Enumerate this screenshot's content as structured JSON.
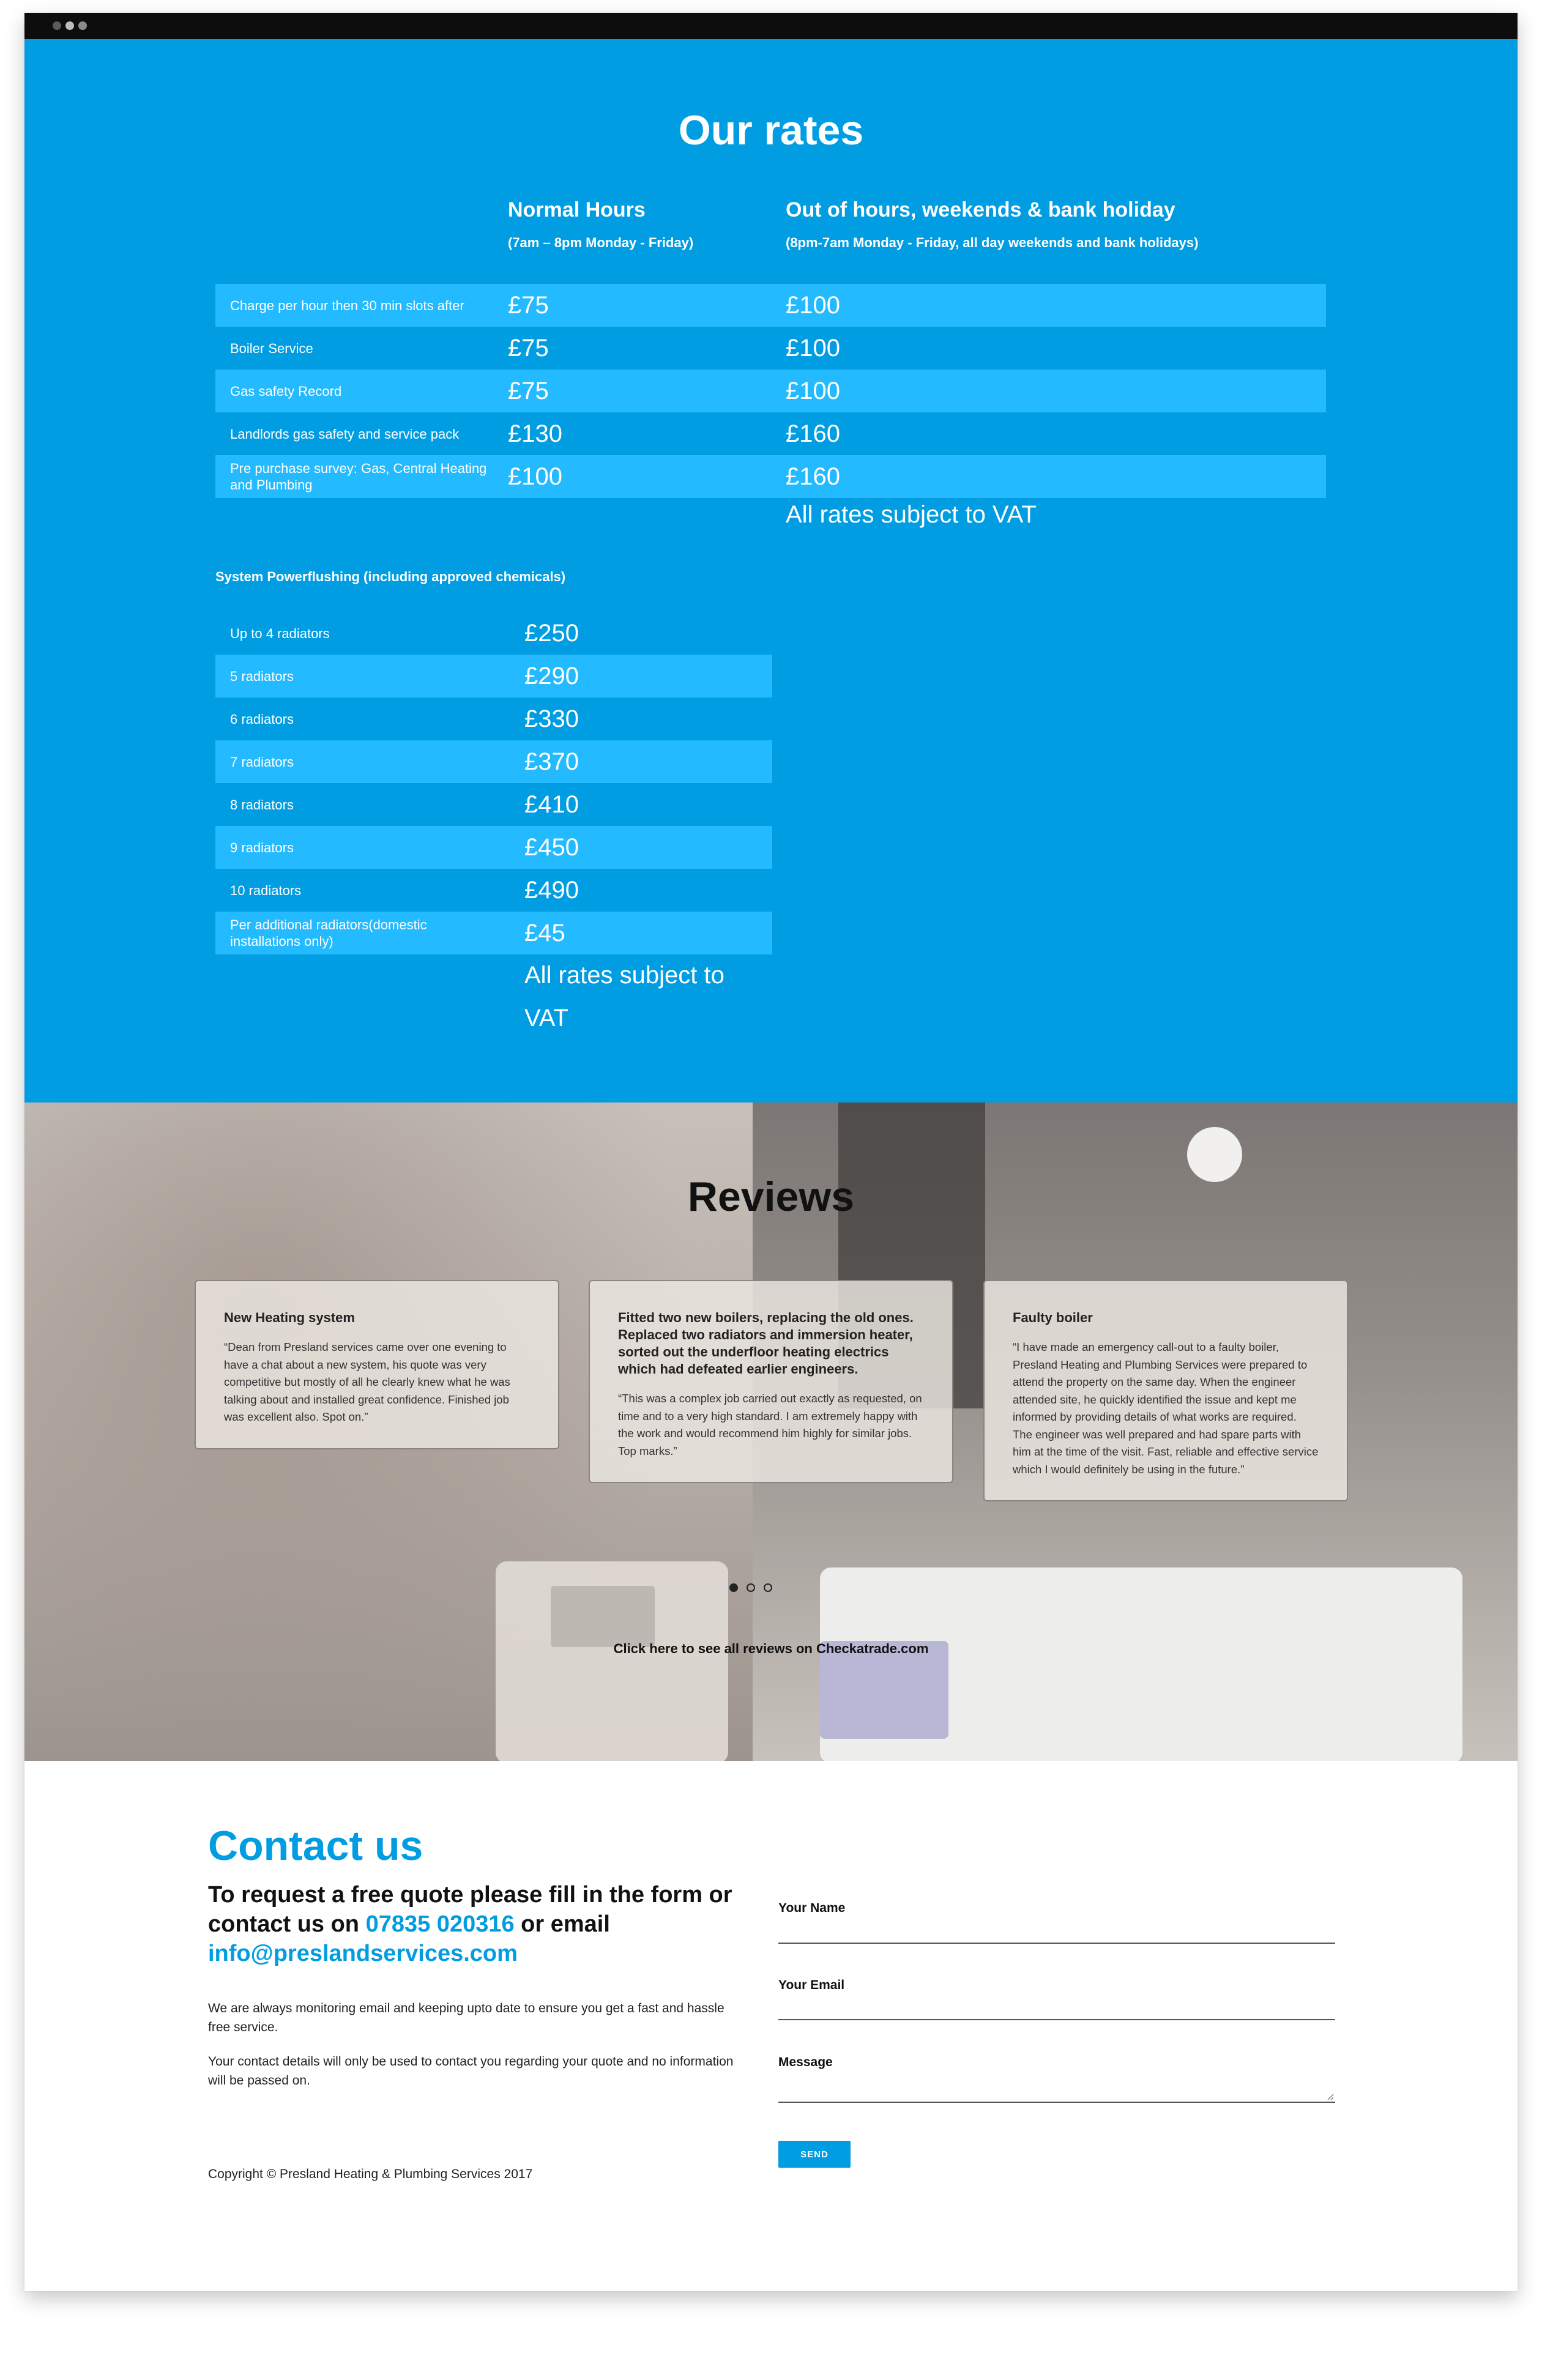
{
  "rates": {
    "title": "Our rates",
    "columns": {
      "normal": {
        "heading": "Normal Hours",
        "sub": "(7am – 8pm Monday - Friday)"
      },
      "out": {
        "heading": "Out of hours, weekends & bank holiday",
        "sub": "(8pm-7am Monday - Friday, all day weekends and bank holidays)"
      }
    },
    "rows": [
      {
        "label": "Charge per hour then 30 min slots after",
        "normal": "£75",
        "out": "£100"
      },
      {
        "label": "Boiler Service",
        "normal": "£75",
        "out": "£100"
      },
      {
        "label": "Gas safety Record",
        "normal": "£75",
        "out": "£100"
      },
      {
        "label": "Landlords gas safety and service pack",
        "normal": "£130",
        "out": "£160"
      },
      {
        "label": "Pre purchase survey: Gas, Central Heating and Plumbing",
        "normal": "£100",
        "out": "£160"
      }
    ],
    "vat_note": "All rates subject to VAT",
    "powerflushing": {
      "title": "System Powerflushing (including approved chemicals)",
      "rows": [
        {
          "label": "Up to 4 radiators",
          "price": "£250"
        },
        {
          "label": "5 radiators",
          "price": "£290"
        },
        {
          "label": "6 radiators",
          "price": "£330"
        },
        {
          "label": "7 radiators",
          "price": "£370"
        },
        {
          "label": "8 radiators",
          "price": "£410"
        },
        {
          "label": "9 radiators",
          "price": "£450"
        },
        {
          "label": "10 radiators",
          "price": "£490"
        },
        {
          "label": "Per additional radiators(domestic installations only)",
          "price": "£45"
        }
      ],
      "vat_note": "All rates subject to VAT"
    }
  },
  "reviews": {
    "title": "Reviews",
    "items": [
      {
        "title": "New Heating system",
        "body": "“Dean from Presland services came over one evening to have a chat about a new system, his quote was very competitive but mostly of all he clearly knew what he was talking about and installed great confidence. Finished job was excellent also. Spot on.”"
      },
      {
        "title": "Fitted two new boilers, replacing the old ones. Replaced two radiators and immersion heater, sorted out the underfloor heating electrics which had defeated earlier engineers.",
        "body": "“This was a complex job carried out exactly as requested, on time and to a very high standard. I am extremely happy with the work and would recommend him highly for similar jobs. Top marks.”"
      },
      {
        "title": "Faulty boiler",
        "body": "“I have made an emergency call-out to a faulty boiler, Presland Heating and Plumbing Services were prepared to attend the property on the same day. When the engineer attended site, he quickly identified the issue and kept me informed by providing details of what works are required. The engineer was well prepared and had spare parts with him at the time of the visit. Fast, reliable and effective service which I would definitely be using in the future.”"
      }
    ],
    "pager": {
      "count": 3,
      "active": 1
    },
    "link_text": "Click here to see all reviews on Checkatrade.com"
  },
  "contact": {
    "title": "Contact us",
    "lead_prefix": "To request a free quote please fill in the form or contact us on ",
    "phone": "07835 020316",
    "lead_middle": " or email ",
    "email": "info@preslandservices.com",
    "para1": "We are always monitoring email and keeping upto date to ensure you get a fast and hassle free service.",
    "para2": "Your contact details will only be used to contact you regarding your quote and no information will be passed on.",
    "copyright": "Copyright © Presland Heating & Plumbing Services 2017",
    "form": {
      "name_label": "Your Name",
      "email_label": "Your Email",
      "message_label": "Message",
      "send_label": "SEND"
    }
  },
  "colors": {
    "brand_blue": "#009de2",
    "row_alt": "#24baff"
  }
}
